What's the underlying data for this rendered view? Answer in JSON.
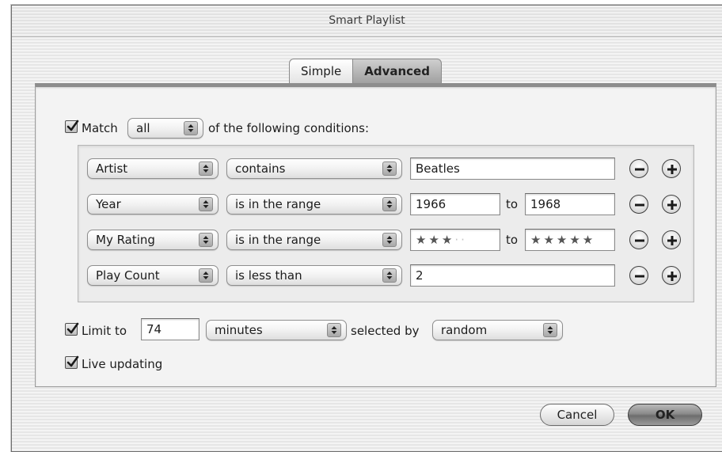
{
  "window": {
    "title": "Smart Playlist"
  },
  "tabs": [
    {
      "label": "Simple",
      "active": false
    },
    {
      "label": "Advanced",
      "active": true
    }
  ],
  "match": {
    "checked": true,
    "label": "Match",
    "selector_value": "all",
    "suffix": "of the following conditions:"
  },
  "conditions": [
    {
      "field": "Artist",
      "operator": "contains",
      "value": "Beatles"
    },
    {
      "field": "Year",
      "operator": "is in the range",
      "from": "1966",
      "to_label": "to",
      "to": "1968"
    },
    {
      "field": "My Rating",
      "operator": "is in the range",
      "from_stars": 3,
      "to_label": "to",
      "to_stars": 5
    },
    {
      "field": "Play Count",
      "operator": "is less than",
      "value": "2"
    }
  ],
  "limit": {
    "checked": true,
    "label": "Limit to",
    "value": "74",
    "unit": "minutes",
    "selected_by_label": "selected by",
    "selected_by": "random"
  },
  "live_updating": {
    "checked": true,
    "label": "Live updating"
  },
  "buttons": {
    "cancel": "Cancel",
    "ok": "OK"
  },
  "colors": {
    "ok_button": "#8a8a8a",
    "selected_tab": "#a8a8a8"
  }
}
